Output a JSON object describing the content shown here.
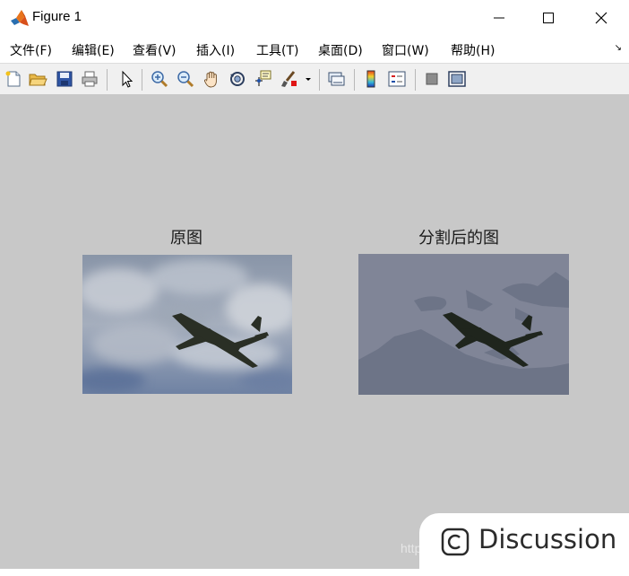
{
  "window": {
    "title": "Figure 1",
    "icon": "matlab-logo-icon",
    "controls": [
      "minimize-icon",
      "maximize-icon",
      "close-icon"
    ]
  },
  "menubar": {
    "items": [
      {
        "label": "文件(F)"
      },
      {
        "label": "编辑(E)"
      },
      {
        "label": "查看(V)"
      },
      {
        "label": "插入(I)"
      },
      {
        "label": "工具(T)"
      },
      {
        "label": "桌面(D)"
      },
      {
        "label": "窗口(W)"
      },
      {
        "label": "帮助(H)"
      }
    ],
    "overflow_arrow": "↘"
  },
  "toolbar": {
    "buttons": [
      "new-figure-icon",
      "open-file-icon",
      "save-icon",
      "print-icon",
      "edit-plot-arrow-icon",
      "zoom-in-icon",
      "zoom-out-icon",
      "pan-hand-icon",
      "rotate-3d-icon",
      "data-cursor-icon",
      "brush-icon",
      "brush-dropdown-icon",
      "link-plot-icon",
      "insert-colorbar-icon",
      "insert-legend-icon",
      "hide-plot-tools-icon",
      "show-plot-tools-icon"
    ]
  },
  "figure": {
    "background_color": "#c8c8c8",
    "subplots": [
      {
        "title": "原图",
        "image": "original-airplane-photo"
      },
      {
        "title": "分割后的图",
        "image": "segmented-airplane-image"
      }
    ]
  },
  "watermark": "http",
  "discussion_badge": {
    "label": "Discussion",
    "icon": "discussion-c-icon"
  }
}
